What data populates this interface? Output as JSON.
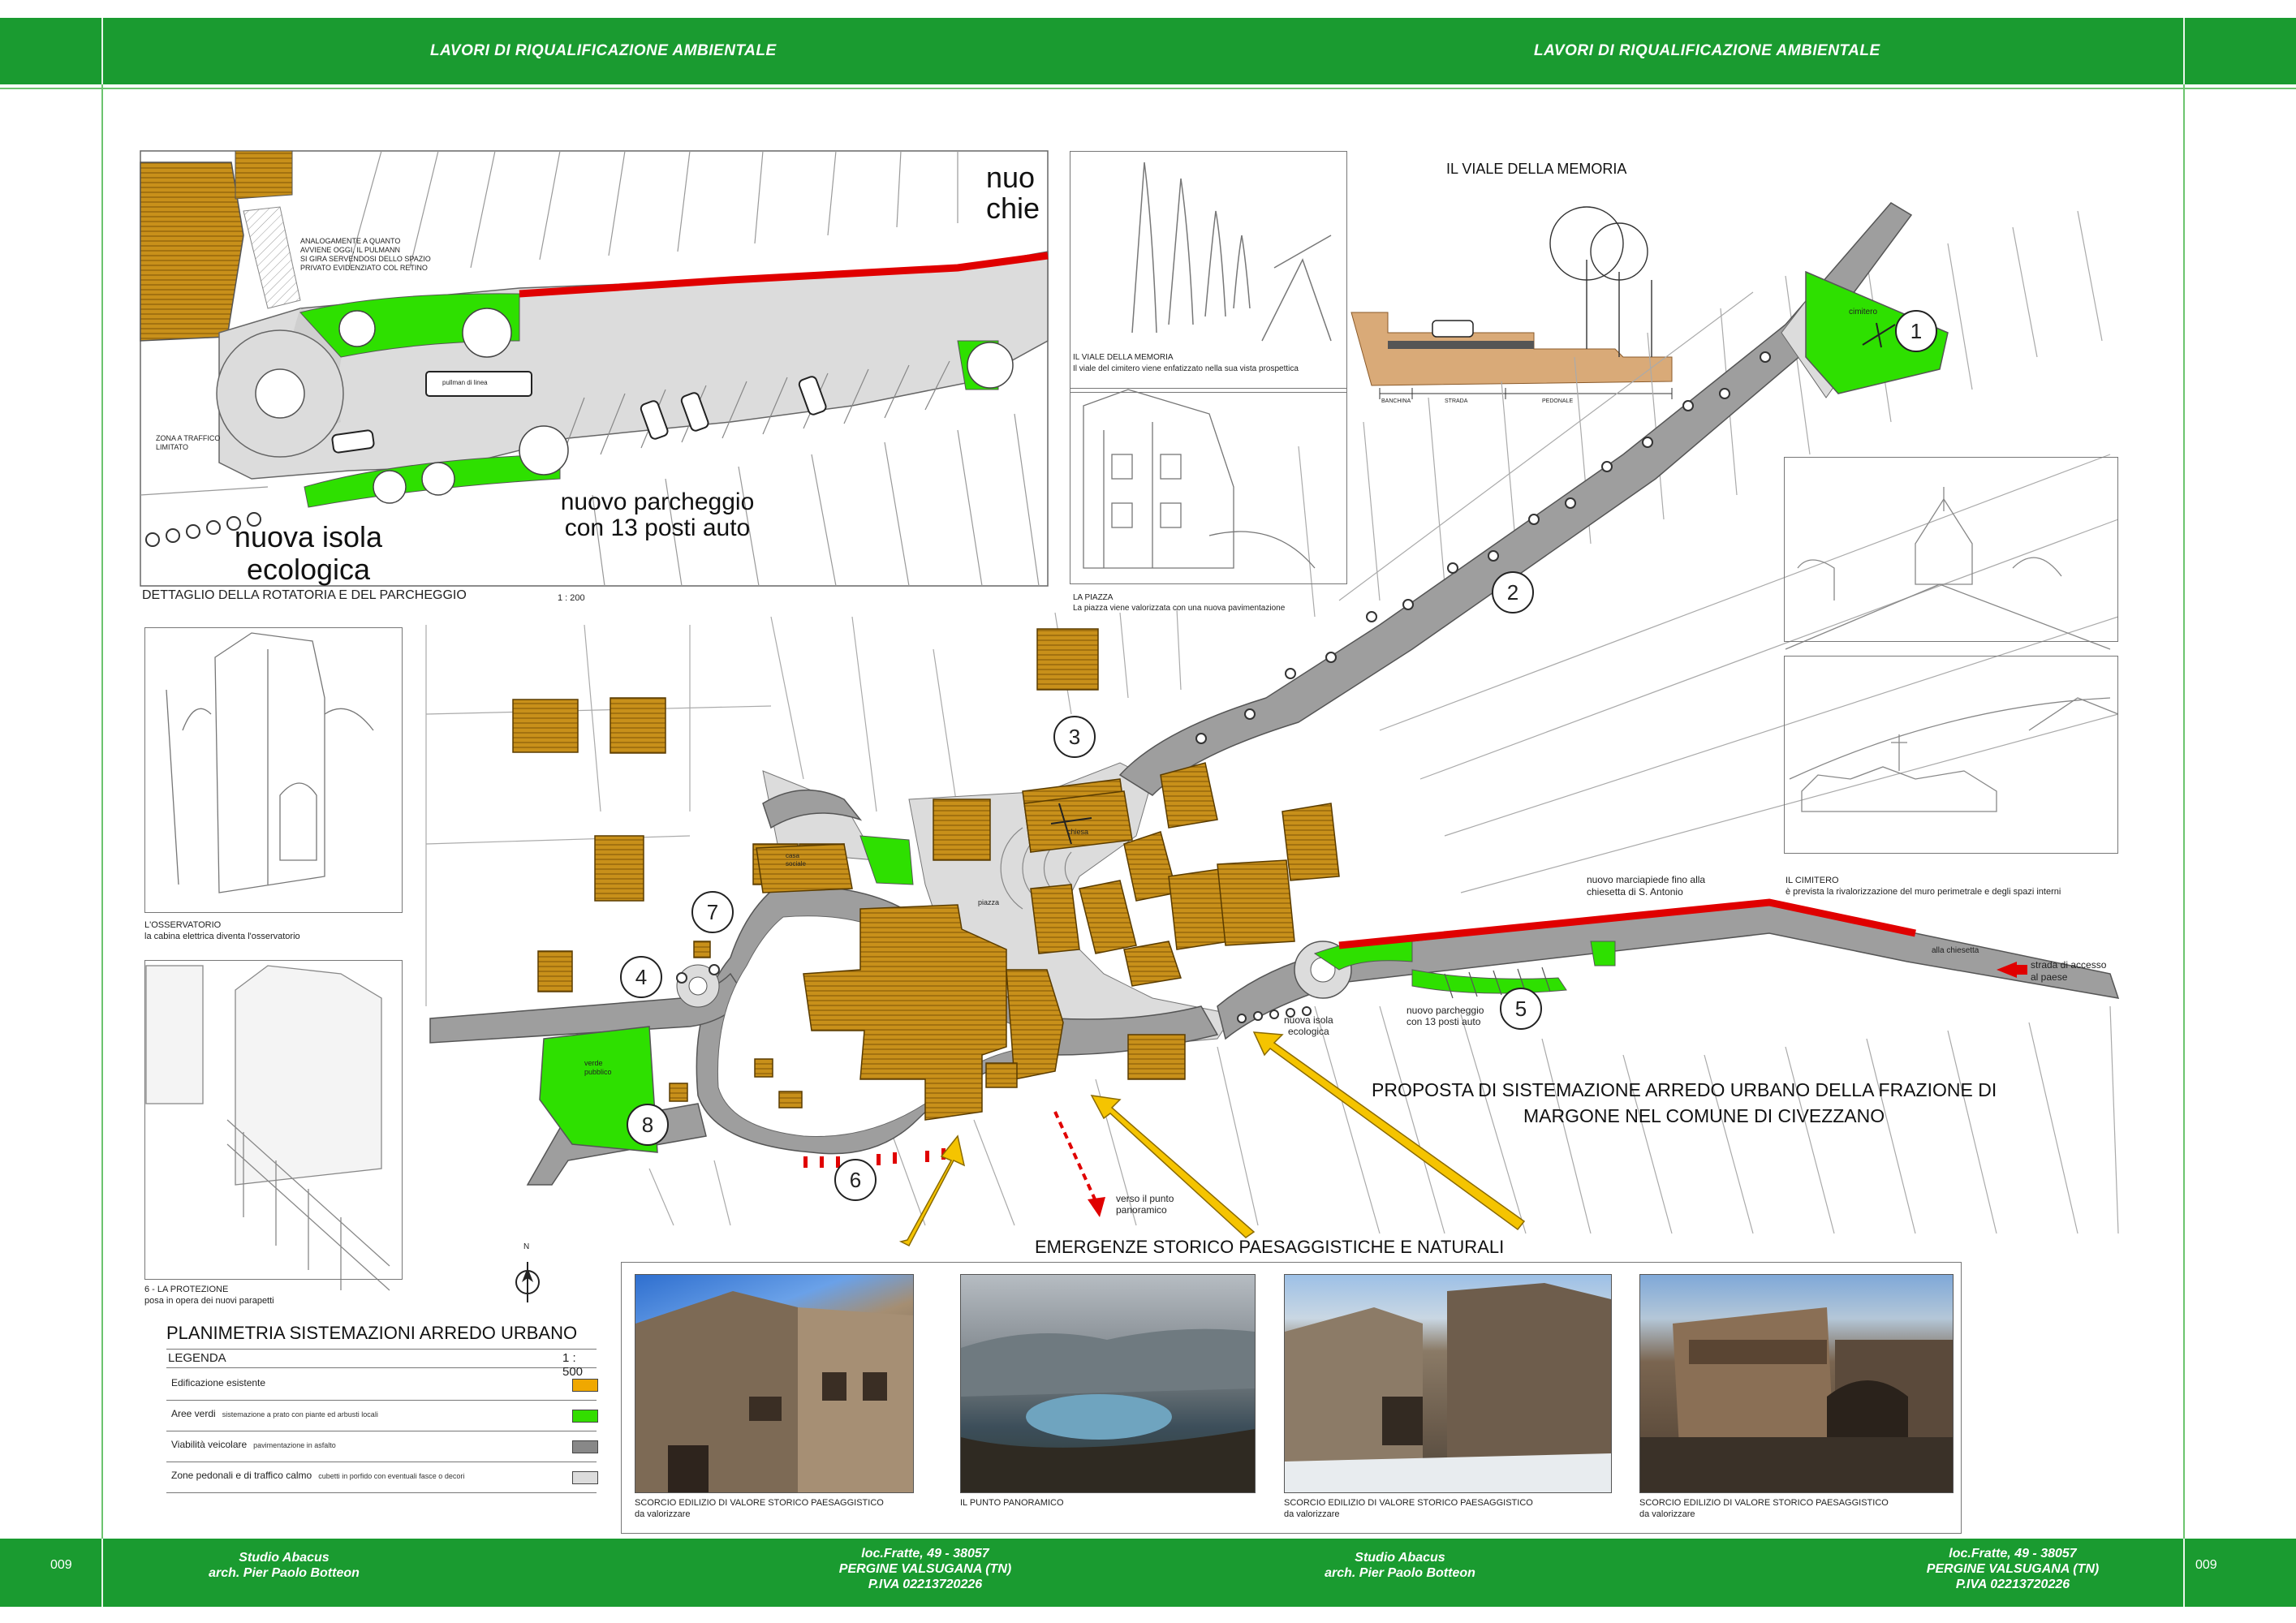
{
  "header": {
    "title_left": "LAVORI DI RIQUALIFICAZIONE AMBIENTALE",
    "title_right": "LAVORI DI RIQUALIFICAZIONE AMBIENTALE"
  },
  "footer": {
    "page_left": "009",
    "page_right": "009",
    "studio_left": "Studio Abacus",
    "arch_left": "arch. Pier Paolo Botteon",
    "addr1_left": "loc.Fratte, 49 - 38057",
    "addr2_left": "PERGINE VALSUGANA (TN)",
    "piva_left": "P.IVA 02213720226",
    "studio_right": "Studio Abacus",
    "arch_right": "arch. Pier Paolo Botteon",
    "addr1_right": "loc.Fratte, 49 - 38057",
    "addr2_right": "PERGINE VALSUGANA (TN)",
    "piva_right": "P.IVA 02213720226"
  },
  "detail": {
    "truncated_label": "nuo\nchie",
    "note": "ANALOGAMENTE A QUANTO\nAVVIENE OGGI, IL PULMANN\nSI GIRA SERVENDOSI DELLO SPAZIO\nPRIVATO EVIDENZIATO COL RETINO",
    "zona": "ZONA A TRAFFICO\nLIMITATO",
    "bus": "pullman di linea",
    "isola": "nuova isola\necologica",
    "parcheggio": "nuovo parcheggio\ncon 13 posti auto",
    "caption": "DETTAGLIO DELLA ROTATORIA E DEL PARCHEGGIO",
    "scale": "1 : 200"
  },
  "viale": {
    "photo_caption": "IL VIALE DELLA MEMORIA",
    "photo_desc": "Il viale del cimitero viene enfatizzato nella sua vista prospettica",
    "section_title": "IL VIALE DELLA MEMORIA",
    "sec_labels": [
      "BANCHINA",
      "STRADA",
      "PEDONALE"
    ]
  },
  "piazza": {
    "caption": "LA PIAZZA",
    "desc": "La piazza viene valorizzata con una nuova pavimentazione"
  },
  "osservatorio": {
    "caption": "L'OSSERVATORIO",
    "desc": "la cabina elettrica diventa l'osservatorio"
  },
  "protezione": {
    "caption": "6 - LA PROTEZIONE",
    "desc": "posa in opera dei nuovi parapetti"
  },
  "cimitero": {
    "caption": "IL CIMITERO",
    "desc": "è prevista la rivalorizzazione del muro perimetrale e degli spazi interni"
  },
  "map": {
    "numbers": [
      "1",
      "2",
      "3",
      "4",
      "5",
      "6",
      "7",
      "8"
    ],
    "cimitero": "cimitero",
    "chiesa": "chiesa",
    "piazza": "piazza",
    "casa": "casa\nsociale",
    "verde": "verde\npubblico",
    "marciapiede": "nuovo marciapiede fino alla\nchiesetta di S. Antonio",
    "alla_chiesetta": "alla chiesetta",
    "strada_accesso": "strada di accesso\nal paese",
    "parcheggio": "nuovo parcheggio\ncon 13 posti auto",
    "isola": "nuova isola\necologica",
    "verso": "verso il punto\npanoramico",
    "north": "N"
  },
  "proposta": {
    "line1": "PROPOSTA  DI  SISTEMAZIONE ARREDO URBANO DELLA FRAZIONE DI",
    "line2": "MARGONE NEL COMUNE DI CIVEZZANO"
  },
  "emergenze": {
    "title": "EMERGENZE STORICO PAESAGGISTICHE E NATURALI",
    "captions": [
      "SCORCIO EDILIZIO DI VALORE STORICO PAESAGGISTICO\nda valorizzare",
      "IL PUNTO PANORAMICO",
      "SCORCIO EDILIZIO DI VALORE STORICO PAESAGGISTICO\nda valorizzare",
      "SCORCIO EDILIZIO DI VALORE STORICO PAESAGGISTICO\nda valorizzare"
    ]
  },
  "legend": {
    "title": "PLANIMETRIA  SISTEMAZIONI ARREDO URBANO",
    "heading": "LEGENDA",
    "scale": "1 : 500",
    "rows": [
      {
        "label": "Edificazione esistente",
        "desc": "",
        "color": "#f0a800"
      },
      {
        "label": "Aree verdi",
        "desc": "sistemazione a prato con piante ed arbusti locali",
        "color": "#33dd00"
      },
      {
        "label": "Viabilità veicolare",
        "desc": "pavimentazione in asfalto",
        "color": "#888888"
      },
      {
        "label": "Zone pedonali e di traffico calmo",
        "desc": "cubetti in porfido con eventuali fasce o decori",
        "color": "#dcdcdc"
      }
    ]
  },
  "colors": {
    "band": "#1a9b30",
    "building": "#c8901a",
    "green": "#2ee000",
    "road": "#9e9e9e",
    "plaza": "#dcdcdc",
    "red": "#e00000",
    "arrow": "#f5c400"
  }
}
